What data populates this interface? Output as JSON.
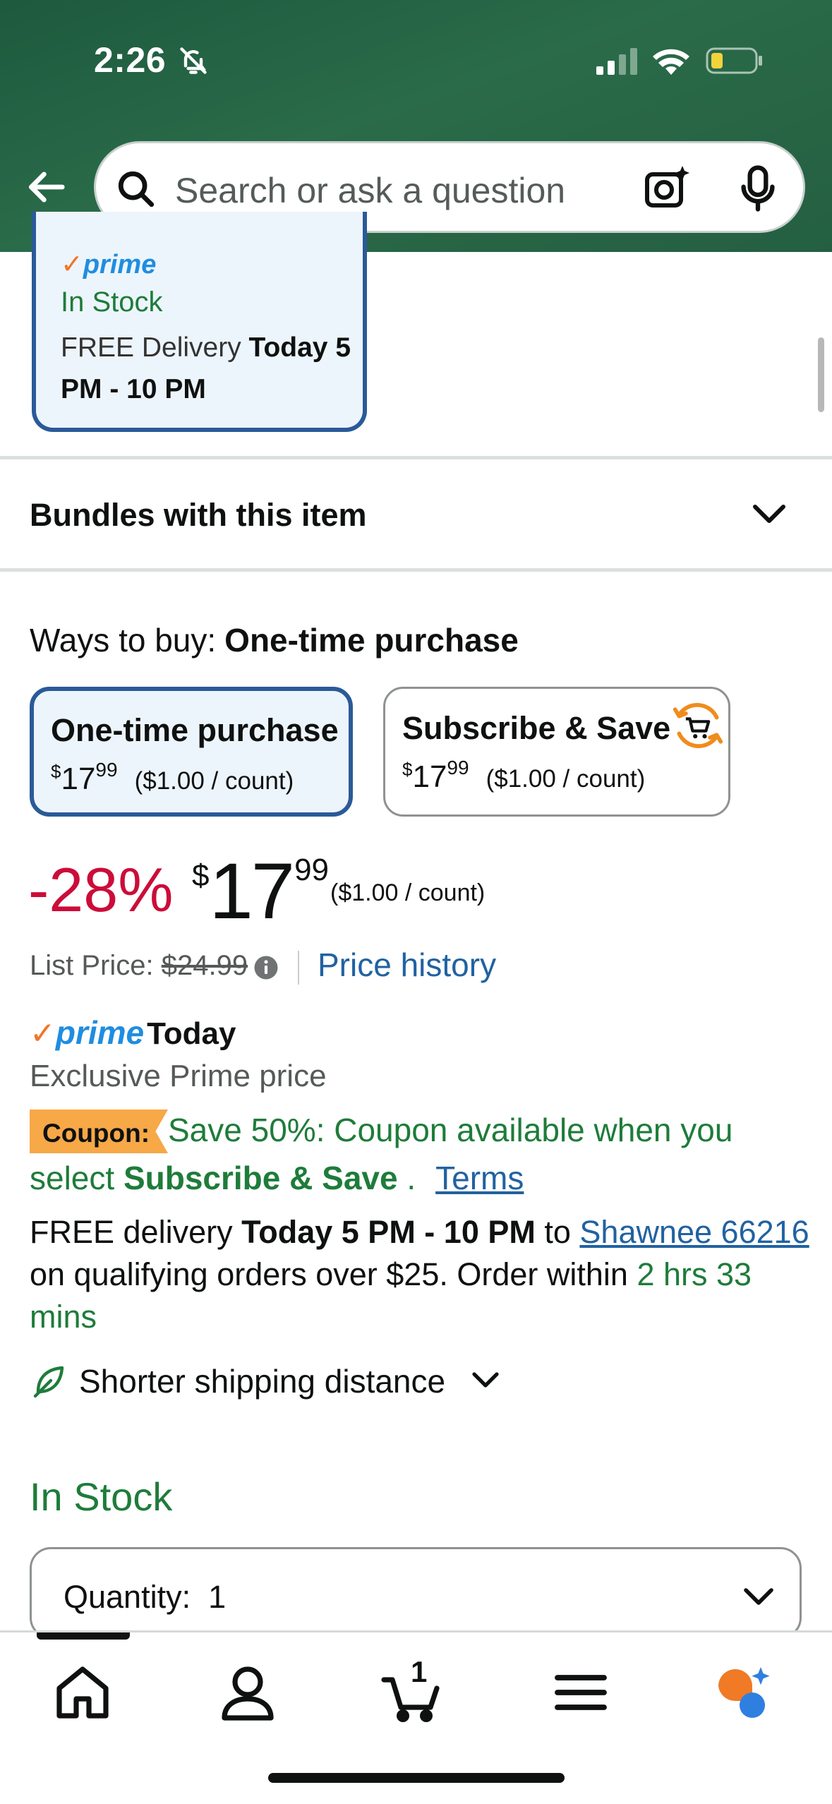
{
  "status_bar": {
    "time": "2:26"
  },
  "search": {
    "placeholder": "Search or ask a question"
  },
  "delivery_card": {
    "prime_label": "prime",
    "stock": "In Stock",
    "delivery_prefix": "FREE Delivery ",
    "delivery_bold": "Today 5 PM - 10 PM"
  },
  "bundles": {
    "title": "Bundles with this item"
  },
  "ways_to_buy": {
    "label": "Ways to buy:",
    "selected": "One-time purchase",
    "options": [
      {
        "title": "One-time purchase",
        "price_whole": "17",
        "price_cents": "99",
        "unit": "($1.00 / count)",
        "selected": true
      },
      {
        "title": "Subscribe & Save",
        "price_whole": "17",
        "price_cents": "99",
        "unit": "($1.00 / count)",
        "selected": false
      }
    ]
  },
  "price": {
    "discount": "-28%",
    "symbol": "$",
    "whole": "17",
    "cents": "99",
    "unit": "($1.00 / count)",
    "list_label": "List Price: ",
    "list_value": "$24.99",
    "history_link": "Price history"
  },
  "prime_today": {
    "check": "✓",
    "prime": "prime",
    "today": "Today",
    "exclusive": "Exclusive Prime price"
  },
  "coupon": {
    "tag": "Coupon:",
    "text": "Save 50%: Coupon available when you",
    "line2_prefix": "select ",
    "line2_bold": "Subscribe & Save",
    "line2_suffix": " .",
    "terms": "Terms"
  },
  "delivery": {
    "prefix": "FREE delivery ",
    "window": "Today 5 PM - 10 PM",
    "to": " to ",
    "location": "Shawnee 66216",
    "suffix": " on qualifying orders over $25. Order within ",
    "countdown": "2 hrs 33 mins"
  },
  "shipping": {
    "label": "Shorter shipping distance"
  },
  "stock": {
    "status": "In Stock"
  },
  "quantity": {
    "label": "Quantity:",
    "value": "1"
  },
  "bottom_nav": {
    "cart_count": "1"
  },
  "colors": {
    "header_green": "#245f41",
    "link_blue": "#2162a1",
    "deal_red": "#cc0c39",
    "stock_green": "#1e7c3a",
    "coupon_orange": "#f7a847",
    "selected_border": "#2a5a98"
  }
}
